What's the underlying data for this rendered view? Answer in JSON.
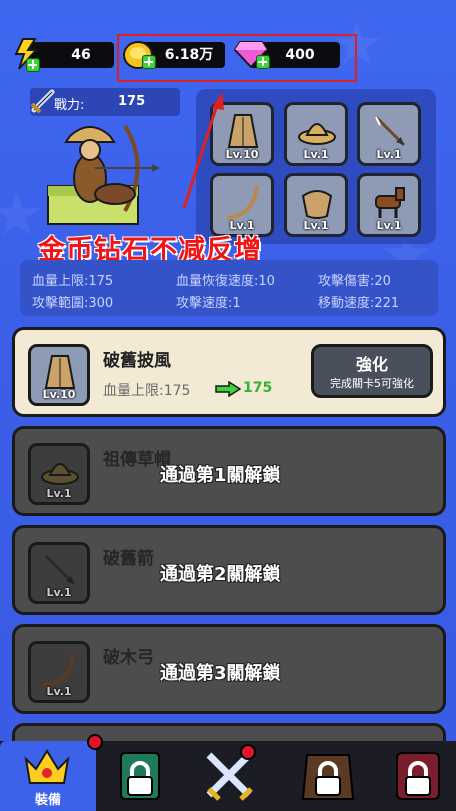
{
  "currency": {
    "energy": "46",
    "gold": "6.18万",
    "gems": "400"
  },
  "power": {
    "label": "戰力:",
    "value": "175"
  },
  "slots": [
    {
      "name": "cloak",
      "level": "Lv.10"
    },
    {
      "name": "straw-hat",
      "level": "Lv.1"
    },
    {
      "name": "arrow",
      "level": "Lv.1"
    },
    {
      "name": "bow",
      "level": "Lv.1"
    },
    {
      "name": "armor",
      "level": "Lv.1"
    },
    {
      "name": "horse",
      "level": "Lv.1"
    }
  ],
  "annotation": "金币钻石不减反增",
  "stats": {
    "hp_max": "血量上限:175",
    "hp_regen": "血量恢復速度:10",
    "atk_dmg": "攻擊傷害:20",
    "atk_range": "攻擊範圍:300",
    "atk_speed": "攻擊速度:1",
    "move_speed": "移動速度:221"
  },
  "items": [
    {
      "name": "破舊披風",
      "level": "Lv.10",
      "stat_current": "血量上限:175",
      "stat_next": "175",
      "upgrade_label": "強化",
      "upgrade_hint": "完成關卡5可強化"
    },
    {
      "name": "祖傳草帽",
      "level": "Lv.1",
      "lock_text": "通過第1關解鎖"
    },
    {
      "name": "破舊箭",
      "level": "Lv.1",
      "lock_text": "通過第2關解鎖"
    },
    {
      "name": "破木弓",
      "level": "Lv.1",
      "lock_text": "通過第3關解鎖"
    }
  ],
  "nav": {
    "equip_label": "裝備"
  }
}
